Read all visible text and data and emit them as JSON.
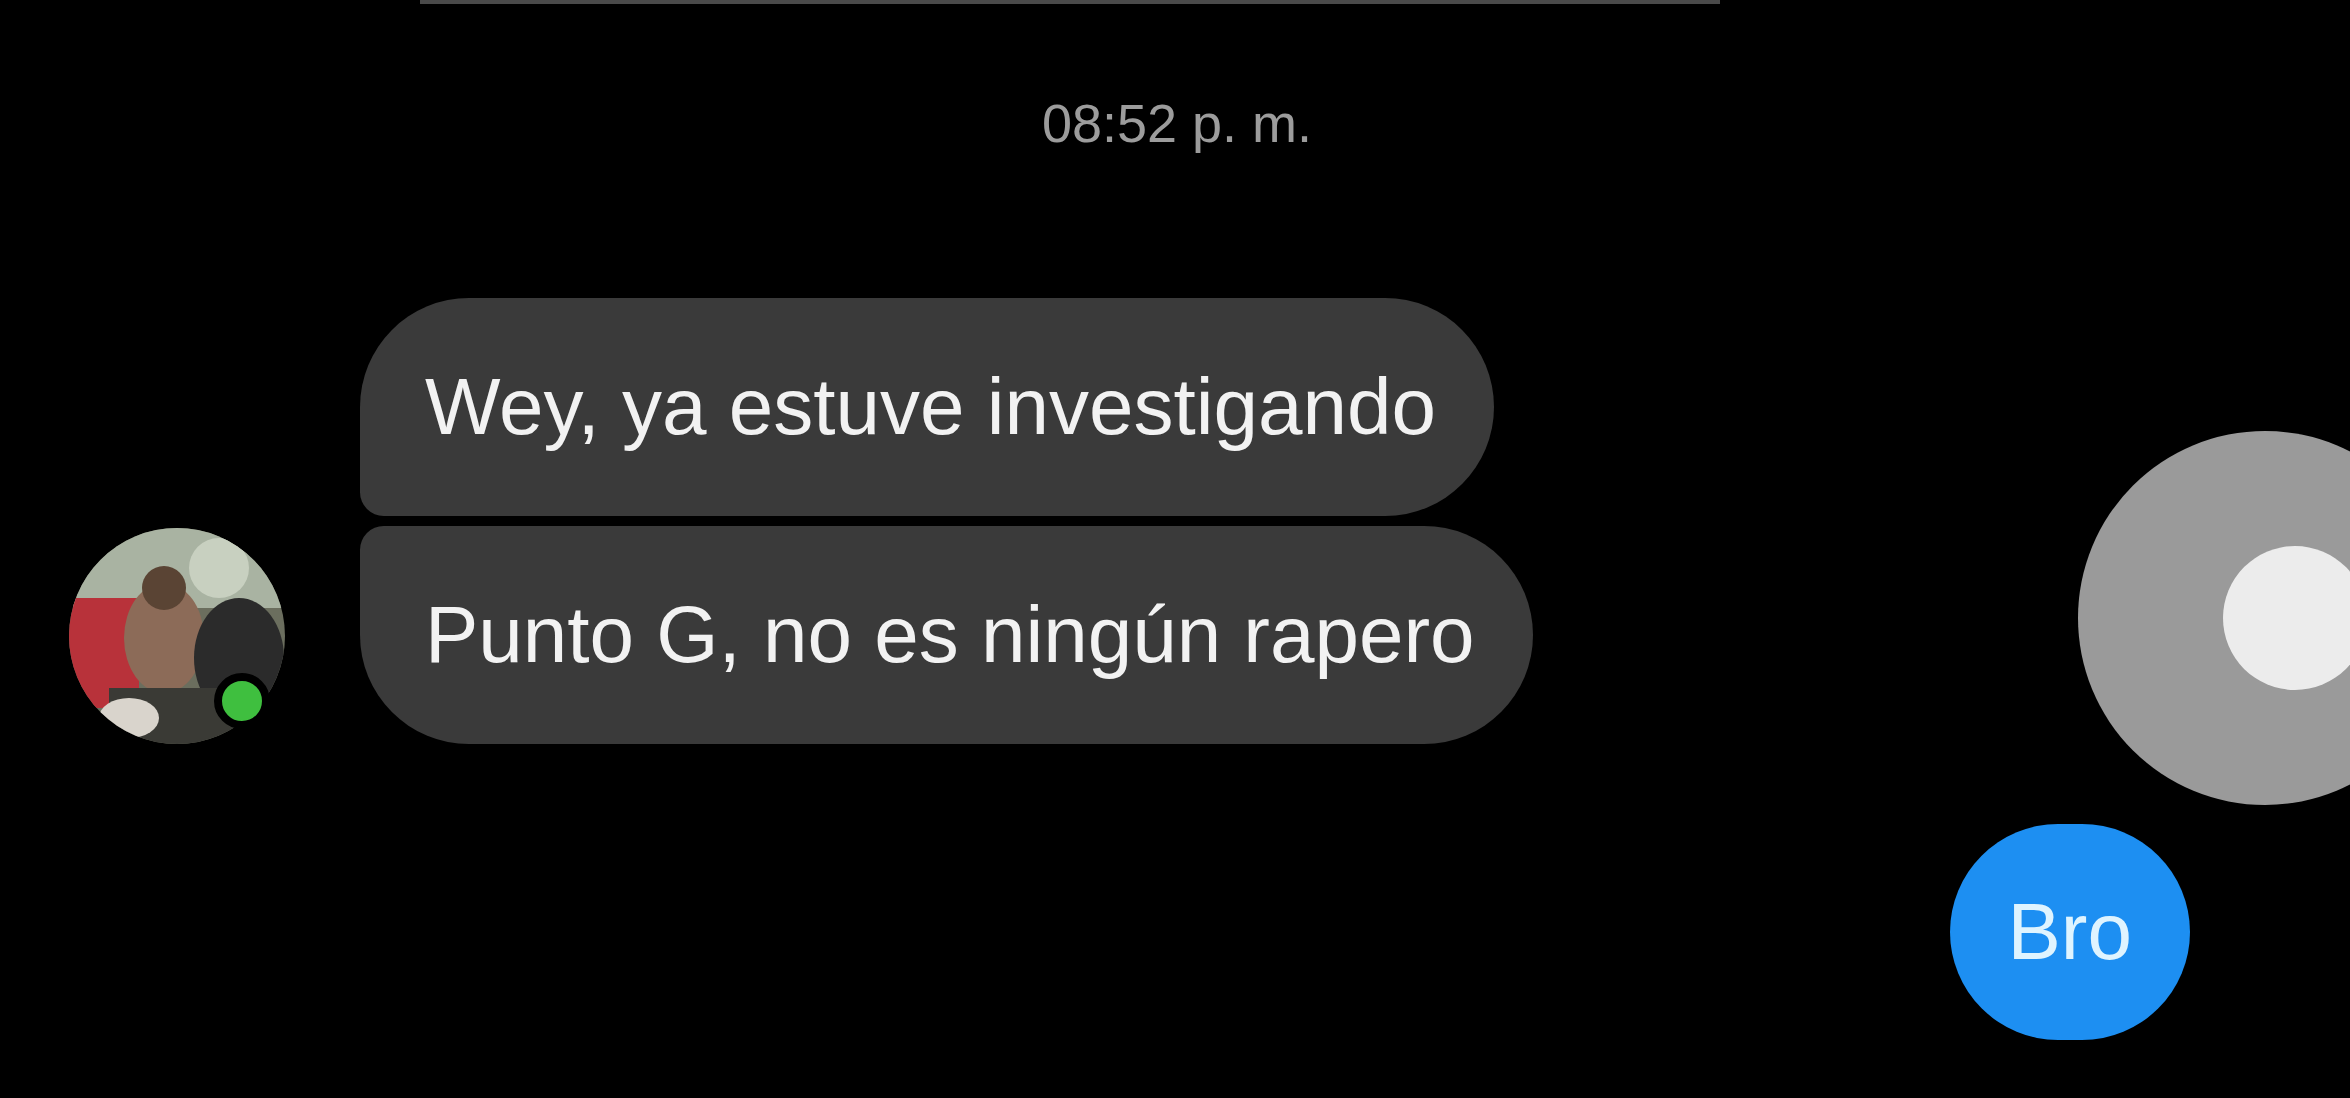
{
  "timestamp": "08:52 p. m.",
  "contact": {
    "online": true
  },
  "messages": [
    {
      "kind": "received",
      "text": "Wey, ya estuve investigando"
    },
    {
      "kind": "received",
      "text": "Punto G, no es ningún rapero"
    },
    {
      "kind": "sent",
      "text": "Bro"
    }
  ]
}
